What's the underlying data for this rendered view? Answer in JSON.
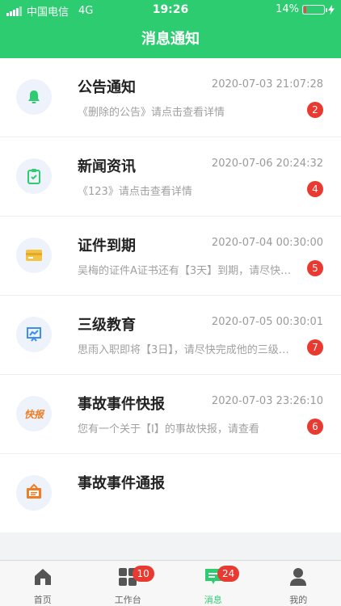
{
  "status": {
    "carrier": "中国电信",
    "network": "4G",
    "time": "19:26",
    "battery": "14%",
    "battery_fraction": 0.14
  },
  "header": {
    "title": "消息通知"
  },
  "items": [
    {
      "title": "公告通知",
      "time": "2020-07-03 21:07:28",
      "desc": "《删除的公告》请点击查看详情",
      "badge": "2",
      "icon": "bell-icon"
    },
    {
      "title": "新闻资讯",
      "time": "2020-07-06 20:24:32",
      "desc": "《123》请点击查看详情",
      "badge": "4",
      "icon": "clipboard-icon"
    },
    {
      "title": "证件到期",
      "time": "2020-07-04 00:30:00",
      "desc": "吴梅的证件A证书还有【3天】到期，请尽快处理",
      "badge": "5",
      "icon": "card-icon"
    },
    {
      "title": "三级教育",
      "time": "2020-07-05 00:30:01",
      "desc": "思雨入职即将【3日】，请尽快完成他的三级教育",
      "badge": "7",
      "icon": "presentation-icon"
    },
    {
      "title": "事故事件快报",
      "time": "2020-07-03 23:26:10",
      "desc": "您有一个关于【I】的事故快报，请查看",
      "badge": "6",
      "icon": "kuaibao-icon",
      "icon_text": "快报"
    },
    {
      "title": "事故事件通报",
      "time": "",
      "desc": "",
      "badge": "",
      "icon": "notice-board-icon"
    }
  ],
  "tabs": [
    {
      "label": "首页",
      "icon": "home-icon",
      "badge": ""
    },
    {
      "label": "工作台",
      "icon": "grid-icon",
      "badge": "10"
    },
    {
      "label": "消息",
      "icon": "message-icon",
      "badge": "24"
    },
    {
      "label": "我的",
      "icon": "user-icon",
      "badge": ""
    }
  ],
  "colors": {
    "accent": "#2ecc71",
    "badge": "#e83a30"
  }
}
